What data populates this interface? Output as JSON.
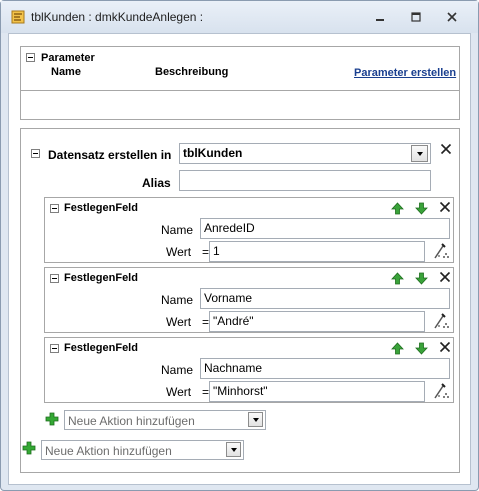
{
  "window": {
    "title": "tblKunden : dmkKundeAnlegen :"
  },
  "parameter": {
    "heading": "Parameter",
    "col_name": "Name",
    "col_description": "Beschreibung",
    "create_link": "Parameter erstellen"
  },
  "create_record": {
    "label": "Datensatz erstellen in",
    "table_value": "tblKunden",
    "alias_label": "Alias",
    "alias_value": ""
  },
  "set_fields": [
    {
      "heading": "FestlegenFeld",
      "name_label": "Name",
      "name_value": "AnredeID",
      "value_label": "Wert",
      "eq": "=",
      "value": "1"
    },
    {
      "heading": "FestlegenFeld",
      "name_label": "Name",
      "name_value": "Vorname",
      "value_label": "Wert",
      "eq": "=",
      "value": "\"André\""
    },
    {
      "heading": "FestlegenFeld",
      "name_label": "Name",
      "name_value": "Nachname",
      "value_label": "Wert",
      "eq": "=",
      "value": "\"Minhorst\""
    }
  ],
  "add_action_inner": {
    "placeholder": "Neue Aktion hinzufügen"
  },
  "add_action_outer": {
    "placeholder": "Neue Aktion hinzufügen"
  },
  "colors": {
    "accent_link": "#1a3f8f",
    "green_arrow": "#2e9a2e",
    "border": "#a7a7a7"
  },
  "icons": [
    "app-icon",
    "minimize-icon",
    "restore-icon",
    "close-icon",
    "collapse-icon",
    "dropdown-arrow-icon",
    "close-x-icon",
    "move-up-icon",
    "move-down-icon",
    "expression-builder-icon",
    "add-action-icon"
  ]
}
